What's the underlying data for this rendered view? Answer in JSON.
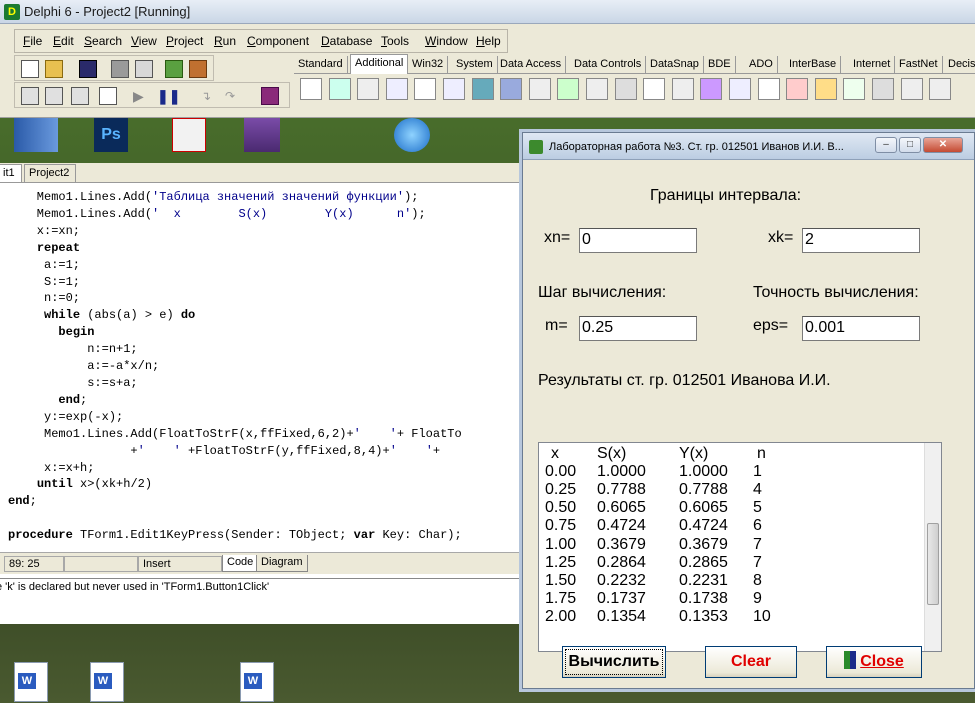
{
  "ide": {
    "title": "Delphi 6 - Project2 [Running]",
    "menu": [
      {
        "label": "File",
        "u": "F"
      },
      {
        "label": "Edit",
        "u": "E"
      },
      {
        "label": "Search",
        "u": "S"
      },
      {
        "label": "View",
        "u": "V"
      },
      {
        "label": "Project",
        "u": "P"
      },
      {
        "label": "Run",
        "u": "R"
      },
      {
        "label": "Component",
        "u": "C"
      },
      {
        "label": "Database",
        "u": "D"
      },
      {
        "label": "Tools",
        "u": "T"
      },
      {
        "label": "Window",
        "u": "W"
      },
      {
        "label": "Help",
        "u": "H"
      }
    ],
    "palette_tabs": [
      "Standard",
      "Additional",
      "Win32",
      "System",
      "Data Access",
      "Data Controls",
      "DataSnap",
      "BDE",
      "ADO",
      "InterBase",
      "Internet",
      "FastNet",
      "Decis"
    ],
    "active_palette_tab": "Additional",
    "component_icons": [
      "pointer-icon",
      "bitbtn-icon",
      "speedbutton-icon",
      "maskedit-icon",
      "stringgrid-icon",
      "drawgrid-icon",
      "image-icon",
      "shape-icon",
      "bevel-icon",
      "scrollbox-icon",
      "checklistbox-icon",
      "splitter-icon",
      "statictext-icon",
      "controlbar-icon",
      "applicationevents-icon",
      "valuelisteditor-icon",
      "labeledit-icon",
      "colorbox-icon",
      "chart-icon",
      "actionmanager-icon",
      "actionmainmenubar-icon",
      "actiontoolbar-icon",
      "customizedlg-icon"
    ]
  },
  "editor": {
    "tabs": [
      "it1",
      "Project2"
    ],
    "code_lines": [
      [
        {
          "t": "    Memo1.Lines.Add(",
          "c": ""
        },
        {
          "t": "'Таблица значений значений функции'",
          "c": "str"
        },
        {
          "t": ");",
          "c": ""
        }
      ],
      [
        {
          "t": "    Memo1.Lines.Add(",
          "c": ""
        },
        {
          "t": "'  x        S(x)        Y(x)      n'",
          "c": "str"
        },
        {
          "t": ");",
          "c": ""
        }
      ],
      [
        {
          "t": "    x:=xn;",
          "c": ""
        }
      ],
      [
        {
          "t": "    ",
          "c": ""
        },
        {
          "t": "repeat",
          "c": "kw"
        }
      ],
      [
        {
          "t": "     a:=1;",
          "c": ""
        }
      ],
      [
        {
          "t": "     S:=1;",
          "c": ""
        }
      ],
      [
        {
          "t": "     n:=0;",
          "c": ""
        }
      ],
      [
        {
          "t": "     ",
          "c": ""
        },
        {
          "t": "while",
          "c": "kw"
        },
        {
          "t": " (abs(a) > e) ",
          "c": ""
        },
        {
          "t": "do",
          "c": "kw"
        }
      ],
      [
        {
          "t": "       ",
          "c": ""
        },
        {
          "t": "begin",
          "c": "kw"
        }
      ],
      [
        {
          "t": "           n:=n+1;",
          "c": ""
        }
      ],
      [
        {
          "t": "           a:=-a*x/n;",
          "c": ""
        }
      ],
      [
        {
          "t": "           s:=s+a;",
          "c": ""
        }
      ],
      [
        {
          "t": "       ",
          "c": ""
        },
        {
          "t": "end",
          "c": "kw"
        },
        {
          "t": ";",
          "c": ""
        }
      ],
      [
        {
          "t": "     y:=exp(-x);",
          "c": ""
        }
      ],
      [
        {
          "t": "     Memo1.Lines.Add(FloatToStrF(x,ffFixed,6,2)+",
          "c": ""
        },
        {
          "t": "'    '",
          "c": "str"
        },
        {
          "t": "+ FloatTo",
          "c": ""
        }
      ],
      [
        {
          "t": "                 +",
          "c": ""
        },
        {
          "t": "'    '",
          "c": "str"
        },
        {
          "t": " +FloatToStrF(y,ffFixed,8,4)+",
          "c": ""
        },
        {
          "t": "'    '",
          "c": "str"
        },
        {
          "t": "+",
          "c": ""
        }
      ],
      [
        {
          "t": "     x:=x+h;",
          "c": ""
        }
      ],
      [
        {
          "t": "    ",
          "c": ""
        },
        {
          "t": "until",
          "c": "kw"
        },
        {
          "t": " x>(xk+h/2)",
          "c": ""
        }
      ],
      [
        {
          "t": "end",
          "c": "kw"
        },
        {
          "t": ";",
          "c": ""
        }
      ],
      [
        {
          "t": "",
          "c": ""
        }
      ],
      [
        {
          "t": "procedure",
          "c": "kw"
        },
        {
          "t": " TForm1.Edit1KeyPress(Sender: TObject; ",
          "c": ""
        },
        {
          "t": "var",
          "c": "kw"
        },
        {
          "t": " Key: Char);",
          "c": ""
        }
      ]
    ],
    "status": {
      "position": "89: 25",
      "mode": "Insert",
      "tab_code": "Code",
      "tab_diagram": "Diagram"
    },
    "message": "e 'k' is declared but never used in 'TForm1.Button1Click'"
  },
  "form": {
    "title": "Лабораторная работа №3. Ст. гр. 012501 Иванов И.И. В...",
    "interval_heading": "Границы интервала:",
    "xn_label": "xn=",
    "xn_value": "0",
    "xk_label": "xk=",
    "xk_value": "2",
    "step_heading": "Шаг вычисления:",
    "precision_heading": "Точность вычисления:",
    "m_label": "m=",
    "m_value": "0.25",
    "eps_label": "eps=",
    "eps_value": "0.001",
    "results_heading": "Результаты ст. гр. 012501 Иванова И.И.",
    "memo_header": [
      "x",
      "S(x)",
      "Y(x)",
      "n"
    ],
    "memo_rows": [
      [
        "0.00",
        "1.0000",
        "1.0000",
        "1"
      ],
      [
        "0.25",
        "0.7788",
        "0.7788",
        "4"
      ],
      [
        "0.50",
        "0.6065",
        "0.6065",
        "5"
      ],
      [
        "0.75",
        "0.4724",
        "0.4724",
        "6"
      ],
      [
        "1.00",
        "0.3679",
        "0.3679",
        "7"
      ],
      [
        "1.25",
        "0.2864",
        "0.2865",
        "7"
      ],
      [
        "1.50",
        "0.2232",
        "0.2231",
        "8"
      ],
      [
        "1.75",
        "0.1737",
        "0.1738",
        "9"
      ],
      [
        "2.00",
        "0.1354",
        "0.1353",
        "10"
      ]
    ],
    "buttons": {
      "calculate": "Вычислить",
      "clear": "Clear",
      "close": "Close",
      "close_underline": "C"
    }
  }
}
